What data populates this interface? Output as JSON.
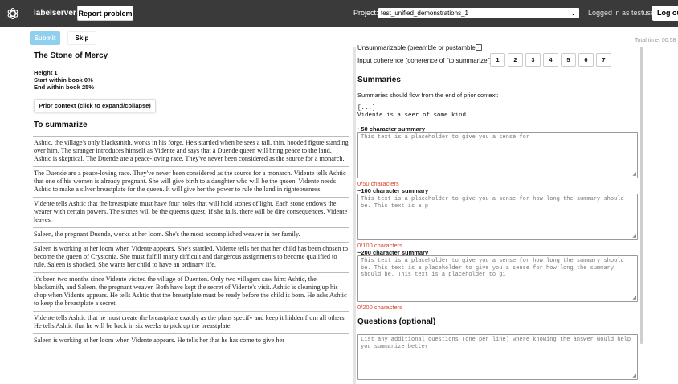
{
  "header": {
    "app_name": "labelserver",
    "report_label": "Report problem",
    "project_label": "Project:",
    "project_value": "test_unified_demonstrations_1",
    "logged_in_text": "Logged in as testuser",
    "logout_label": "Log out"
  },
  "controls": {
    "submit_label": "Submit",
    "skip_label": "Skip",
    "total_time": "Total time: 00:58"
  },
  "book": {
    "title": "The Stone of Mercy",
    "height": "Height 1",
    "start": "Start within book 0%",
    "end": "End within book 25%",
    "prior_context_label": "Prior context (click to expand/collapse)",
    "to_summarize_heading": "To summarize"
  },
  "passages": [
    "Ashtic, the village's only blacksmith, works in his forge. He's startled when he sees a tall, thin, hooded figure standing over him. The stranger introduces himself as Vidente and says that a Duende queen will bring peace to the land. Ashtic is skeptical. The Duende are a peace-loving race. They've never been considered as the source for a monarch.",
    "The Duende are a peace-loving race. They've never been considered as the source for a monarch. Vidente tells Ashtic that one of his women is already pregnant. She will give birth to a daughter who will be the queen. Vidente needs Ashtic to make a silver breastplate for the queen. It will give her the power to rule the land in righteousness.",
    "Vidente tells Ashtic that the breastplate must have four holes that will hold stones of light. Each stone endows the wearer with certain powers. The stones will be the queen's quest. If she fails, there will be dire consequences. Vidente leaves.",
    "Saleen, the pregnant Duende, works at her loom. She's the most accomplished weaver in her family.",
    "Saleen is working at her loom when Vidente appears. She's startled. Vidente tells her that her child has been chosen to become the queen of Crystonia. She must fulfill many difficult and dangerous assignments to become qualified to rule. Saleen is shocked. She wants her child to have an ordinary life.",
    "It's been two months since Vidente visited the village of Duenton. Only two villagers saw him: Ashtic, the blacksmith, and Saleen, the pregnant weaver. Both have kept the secret of Vidente's visit. Ashtic is cleaning up his shop when Vidente appears. He tells Ashtic that the breastplate must be ready before the child is born. He asks Ashtic to keep the breastplate a secret.",
    "Vidente tells Ashtic that he must create the breastplate exactly as the plans specify and keep it hidden from all others. He tells Ashtic that he will be back in six weeks to pick up the breastplate.",
    "Saleen is working at her loom when Vidente appears. He tells her that he has come to give her"
  ],
  "summary_panel": {
    "unsummarizable_label": "Unsummarizable (preamble or postamble):",
    "coherence_label": "Input coherence (coherence of \"to summarize\")",
    "coherence_options": [
      "1",
      "2",
      "3",
      "4",
      "5",
      "6",
      "7"
    ],
    "summaries_heading": "Summaries",
    "flow_note": "Summaries should flow from the end of prior context:",
    "context_ellipsis": "[...]",
    "context_line": "Vidente is a seer of some kind",
    "summary_50": {
      "label": "~50 character summary",
      "placeholder": "This text is a placeholder to give you a sense for",
      "count": "0/50 characters"
    },
    "summary_100": {
      "label": "~100 character summary",
      "placeholder": "This text is a placeholder to give you a sense for how long the summary should be.  This text is a p",
      "count": "0/100 characters"
    },
    "summary_200": {
      "label": "~200 character summary",
      "placeholder": "This text is a placeholder to give you a sense for how long the summary should be.  This text is a placeholder to give you a sense for how long the summary should be.  This text is a placeholder to gi",
      "count": "0/200 characters"
    },
    "questions_heading": "Questions (optional)",
    "questions_placeholder": "List any additional questions (one per line) where knowing the answer would help you summarize better"
  },
  "colors": {
    "topbar": "#3a3a3a",
    "submit": "#8fd0ee",
    "char_count": "#d9432f"
  }
}
